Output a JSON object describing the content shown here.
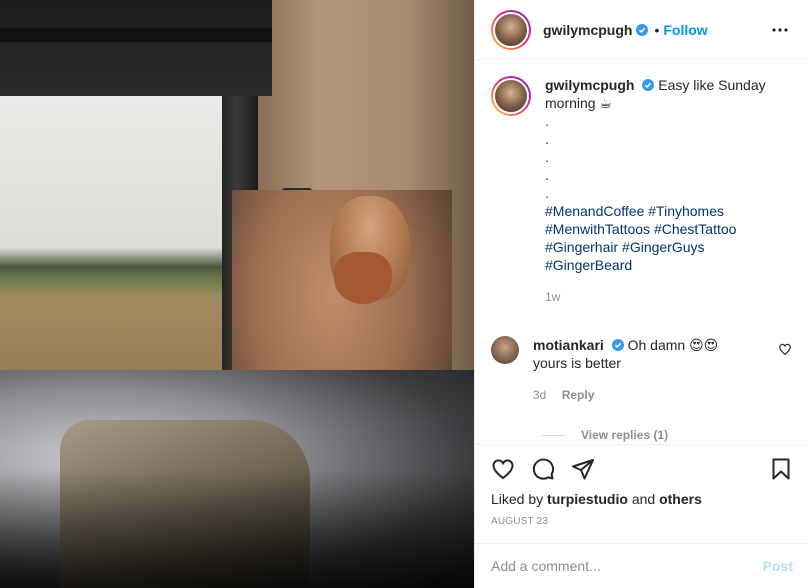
{
  "post": {
    "author": "gwilymcpugh",
    "follow_label": "Follow",
    "dot": "•",
    "caption": "Easy like Sunday morning",
    "caption_emoji": "☕",
    "caption_dots": [
      ".",
      ".",
      ".",
      ".",
      "."
    ],
    "hashtags": [
      "#MenandCoffee #Tinyhomes",
      "#MenwithTattoos #ChestTattoo",
      "#Gingerhair #GingerGuys",
      "#GingerBeard"
    ],
    "caption_time": "1w"
  },
  "comment": {
    "author": "motiankari",
    "text_line1": "Oh damn",
    "emojis": "😍😍",
    "text_line2": "yours is better",
    "time": "3d",
    "reply_label": "Reply",
    "view_replies": "View replies (1)"
  },
  "footer": {
    "liked_prefix": "Liked by",
    "liked_user": "turpiestudio",
    "liked_and": "and",
    "liked_others": "others",
    "date": "August 23",
    "comment_placeholder": "Add a comment...",
    "post_label": "Post"
  },
  "icons": {
    "verified": "verified-badge-icon",
    "more": "more-options-icon",
    "like": "heart-icon",
    "comment": "comment-icon",
    "share": "share-icon",
    "save": "bookmark-icon"
  },
  "colors": {
    "link_blue": "#0095f6",
    "hashtag": "#00376b",
    "muted": "#8e8e8e",
    "post_disabled": "#b2dffc"
  }
}
